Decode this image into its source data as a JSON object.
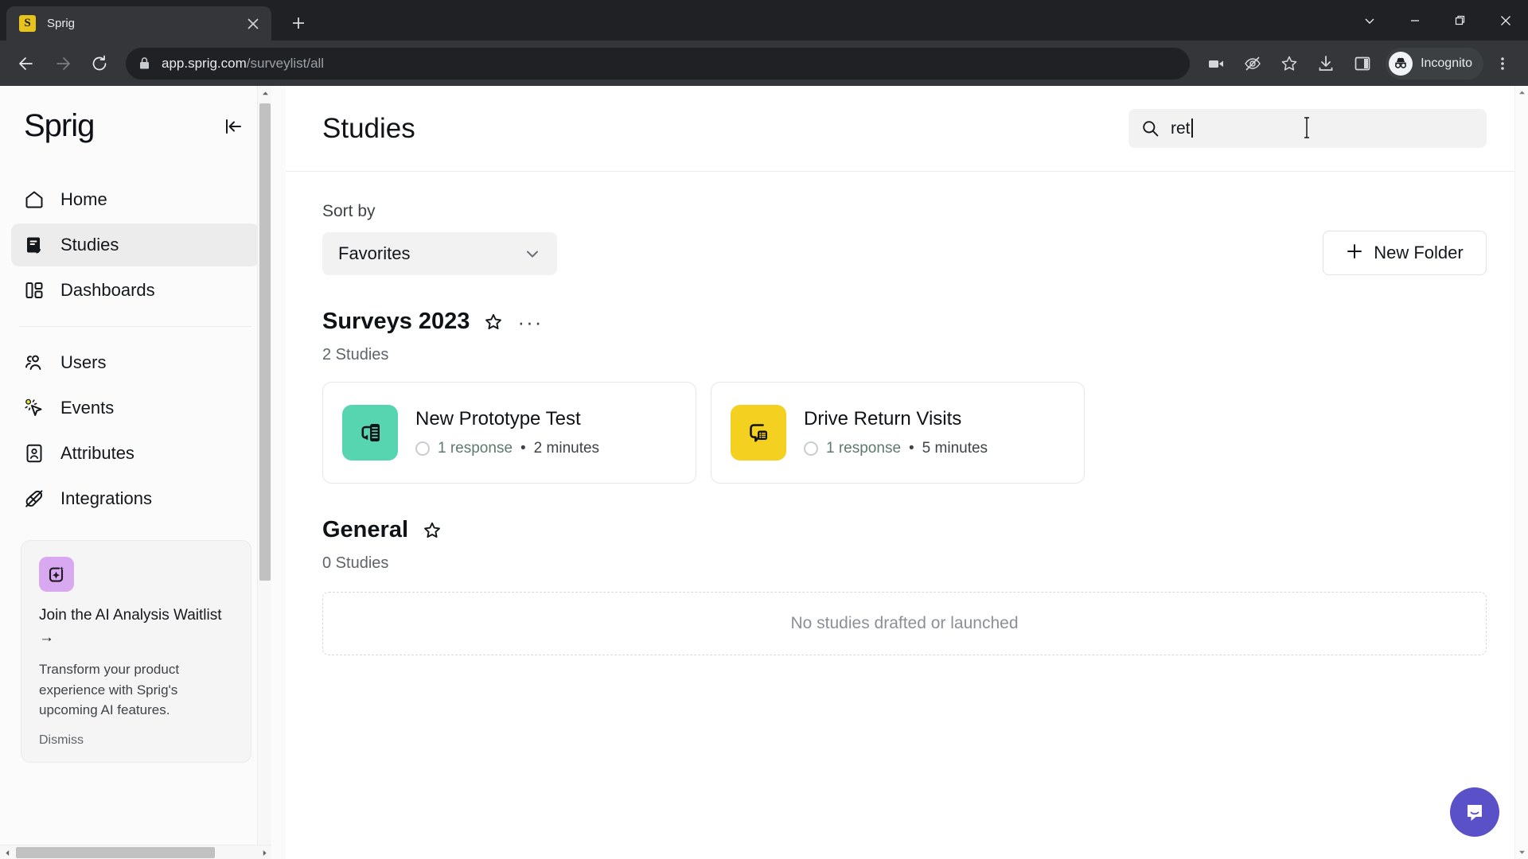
{
  "browser": {
    "tab": {
      "title": "Sprig",
      "favicon_letter": "S",
      "favicon_color": "#e8c31b",
      "close_icon": "close-icon"
    },
    "new_tab_icon": "plus-icon",
    "window_controls": [
      "tab-search-chevron-icon",
      "minimize-icon",
      "maximize-icon",
      "close-window-icon"
    ],
    "nav": {
      "back_icon": "arrow-left-icon",
      "forward_icon": "arrow-right-icon",
      "reload_icon": "reload-icon"
    },
    "omnibox": {
      "lock_icon": "lock-icon",
      "domain": "app.sprig.com",
      "path": "/surveylist/all"
    },
    "toolbar_icons": [
      "video-camera-icon",
      "eye-slash-icon",
      "star-icon",
      "download-icon",
      "side-panel-icon"
    ],
    "profile": {
      "label": "Incognito",
      "icon": "incognito-icon"
    },
    "menu_icon": "kebab-menu-icon"
  },
  "sidebar": {
    "logo": "Sprig",
    "collapse_icon": "collapse-sidebar-icon",
    "items": [
      {
        "label": "Home",
        "icon": "home-icon",
        "active": false
      },
      {
        "label": "Studies",
        "icon": "studies-icon",
        "active": true
      },
      {
        "label": "Dashboards",
        "icon": "dashboards-icon",
        "active": false
      },
      {
        "label": "Users",
        "icon": "users-icon",
        "active": false
      },
      {
        "label": "Events",
        "icon": "events-cursor-icon",
        "active": false
      },
      {
        "label": "Attributes",
        "icon": "attributes-id-icon",
        "active": false
      },
      {
        "label": "Integrations",
        "icon": "integrations-plug-icon",
        "active": false
      }
    ],
    "promo": {
      "icon": "ai-sparkle-icon",
      "title": "Join the AI Analysis Waitlist →",
      "body": "Transform your product experience with Sprig's upcoming AI features.",
      "dismiss_label": "Dismiss"
    }
  },
  "main": {
    "title": "Studies",
    "search": {
      "value": "ret",
      "placeholder": "Search",
      "icon": "search-icon"
    },
    "sort": {
      "label": "Sort by",
      "value": "Favorites",
      "chevron_icon": "chevron-down-icon"
    },
    "new_folder": {
      "label": "New Folder",
      "icon": "plus-icon"
    },
    "folders": [
      {
        "name": "Surveys 2023",
        "star_icon": "star-outline-icon",
        "more_icon": "ellipsis-icon",
        "count_label": "2 Studies",
        "studies": [
          {
            "name": "New Prototype Test",
            "icon": "prototype-study-icon",
            "icon_bg": "#57d4b0",
            "responses": "1 response",
            "separator": "•",
            "duration": "2 minutes",
            "status_icon": "status-ring-icon"
          },
          {
            "name": "Drive Return Visits",
            "icon": "survey-study-icon",
            "icon_bg": "#f4d020",
            "responses": "1 response",
            "separator": "•",
            "duration": "5 minutes",
            "status_icon": "status-ring-icon"
          }
        ]
      },
      {
        "name": "General",
        "star_icon": "star-outline-icon",
        "more_icon": "",
        "count_label": "0 Studies",
        "studies": [],
        "empty_text": "No studies drafted or launched"
      }
    ],
    "intercom": {
      "icon": "intercom-chat-icon",
      "color": "#5a50c8"
    }
  }
}
